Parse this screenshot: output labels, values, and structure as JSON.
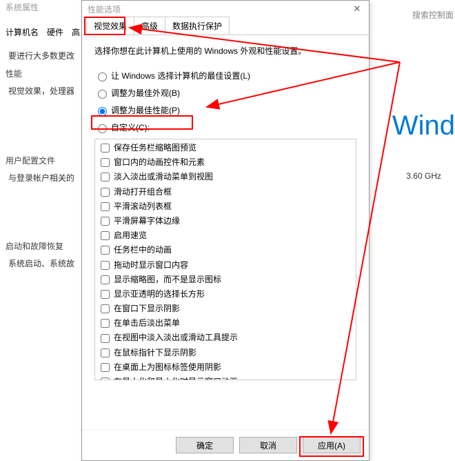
{
  "bg": {
    "title": "系统属性",
    "search_placeholder": "搜索控制面",
    "tabs": [
      "计算机名",
      "硬件",
      "高"
    ],
    "change_note": "要进行大多数更改",
    "perf_group": {
      "title": "性能",
      "body": "视觉效果，处理器"
    },
    "user_group": {
      "title": "用户配置文件",
      "body": "与登录帐户相关的"
    },
    "start_group": {
      "title": "启动和故障恢复",
      "body": "系统启动、系统故"
    },
    "cpu": "3.60 GHz",
    "win_brand": "Wind"
  },
  "dialog": {
    "title": "性能选项",
    "tabs": [
      {
        "label": "视觉效果",
        "active": true
      },
      {
        "label": "高级",
        "active": false
      },
      {
        "label": "数据执行保护",
        "active": false
      }
    ],
    "desc": "选择你想在此计算机上使用的 Windows 外观和性能设置。",
    "radios": [
      {
        "label": "让 Windows 选择计算机的最佳设置(L)",
        "checked": false
      },
      {
        "label": "调整为最佳外观(B)",
        "checked": false
      },
      {
        "label": "调整为最佳性能(P)",
        "checked": true
      },
      {
        "label": "自定义(C):",
        "checked": false
      }
    ],
    "checks": [
      "保存任务栏缩略图预览",
      "窗口内的动画控件和元素",
      "淡入淡出或滑动菜单到视图",
      "滑动打开组合框",
      "平滑滚动列表框",
      "平滑屏幕字体边缘",
      "启用速览",
      "任务栏中的动画",
      "拖动时显示窗口内容",
      "显示缩略图，而不是显示图标",
      "显示亚透明的选择长方形",
      "在窗口下显示阴影",
      "在单击后淡出菜单",
      "在视图中淡入淡出或滑动工具提示",
      "在鼠标指针下显示阴影",
      "在桌面上为图标标签使用阴影",
      "在最大化和最小化时显示窗口动画"
    ],
    "buttons": {
      "ok": "确定",
      "cancel": "取消",
      "apply": "应用(A)"
    }
  }
}
